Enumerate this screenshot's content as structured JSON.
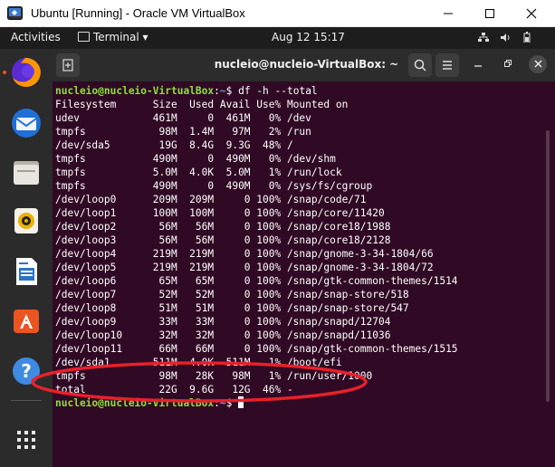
{
  "window": {
    "title": "Ubuntu [Running] - Oracle VM VirtualBox"
  },
  "topbar": {
    "activities": "Activities",
    "app_menu": "Terminal",
    "app_menu_arrow": "▾",
    "clock": "Aug 12  15:17"
  },
  "terminal": {
    "title": "nucleio@nucleio-VirtualBox: ~",
    "prompt_user": "nucleio@nucleio-VirtualBox",
    "prompt_colon": ":",
    "prompt_path": "~",
    "prompt_dollar": "$ ",
    "command": "df -h --total",
    "header": "Filesystem      Size  Used Avail Use% Mounted on",
    "rows": [
      "udev            461M     0  461M   0% /dev",
      "tmpfs            98M  1.4M   97M   2% /run",
      "/dev/sda5        19G  8.4G  9.3G  48% /",
      "tmpfs           490M     0  490M   0% /dev/shm",
      "tmpfs           5.0M  4.0K  5.0M   1% /run/lock",
      "tmpfs           490M     0  490M   0% /sys/fs/cgroup",
      "/dev/loop0      209M  209M     0 100% /snap/code/71",
      "/dev/loop1      100M  100M     0 100% /snap/core/11420",
      "/dev/loop2       56M   56M     0 100% /snap/core18/1988",
      "/dev/loop3       56M   56M     0 100% /snap/core18/2128",
      "/dev/loop4      219M  219M     0 100% /snap/gnome-3-34-1804/66",
      "/dev/loop5      219M  219M     0 100% /snap/gnome-3-34-1804/72",
      "/dev/loop6       65M   65M     0 100% /snap/gtk-common-themes/1514",
      "/dev/loop7       52M   52M     0 100% /snap/snap-store/518",
      "/dev/loop8       51M   51M     0 100% /snap/snap-store/547",
      "/dev/loop9       33M   33M     0 100% /snap/snapd/12704",
      "/dev/loop10      32M   32M     0 100% /snap/snapd/11036",
      "/dev/loop11      66M   66M     0 100% /snap/gtk-common-themes/1515",
      "/dev/sda1       511M  4.0K  511M   1% /boot/efi",
      "tmpfs            98M   28K   98M   1% /run/user/1000",
      "total            22G  9.6G   12G  46% -"
    ]
  },
  "colors": {
    "terminal_bg": "#300a24",
    "prompt_user": "#8ae234",
    "prompt_path": "#729fcf",
    "annotation": "#e8202a",
    "dock_bg": "#2b2b2b"
  },
  "dock_icons": [
    "firefox-icon",
    "thunderbird-icon",
    "files-icon",
    "rhythmbox-icon",
    "libreoffice-writer-icon",
    "software-icon",
    "help-icon",
    "show-applications-icon"
  ]
}
